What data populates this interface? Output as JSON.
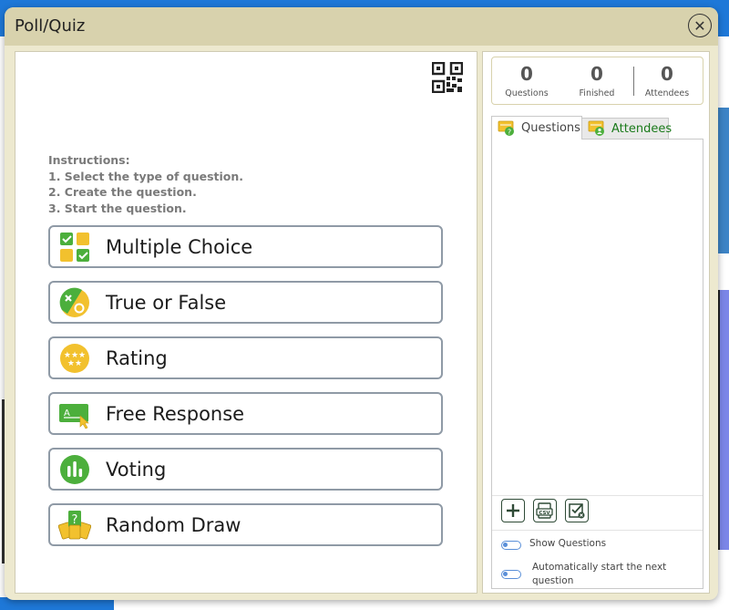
{
  "window": {
    "title": "Poll/Quiz",
    "close_label": "✕"
  },
  "instructions": {
    "heading": "Instructions:",
    "steps": [
      "1. Select the type of question.",
      "2. Create the question.",
      "3. Start the question."
    ]
  },
  "question_types": [
    {
      "label": "Multiple Choice",
      "icon": "multiple-choice-icon"
    },
    {
      "label": "True or False",
      "icon": "true-false-icon"
    },
    {
      "label": "Rating",
      "icon": "rating-icon"
    },
    {
      "label": "Free Response",
      "icon": "free-response-icon"
    },
    {
      "label": "Voting",
      "icon": "voting-icon"
    },
    {
      "label": "Random Draw",
      "icon": "random-draw-icon"
    }
  ],
  "stats": [
    {
      "value": "0",
      "label": "Questions"
    },
    {
      "value": "0",
      "label": "Finished"
    },
    {
      "value": "0",
      "label": "Attendees"
    }
  ],
  "tabs": {
    "questions": "Questions",
    "attendees": "Attendees",
    "active": "Questions"
  },
  "options": {
    "show_questions": "Show Questions",
    "auto_start_line1": "Automatically start the next",
    "auto_start_line2": "question"
  },
  "colors": {
    "title_bar": "#d8d2ad",
    "dialog_bg": "#ede9cf",
    "icon_green": "#4caf3c",
    "icon_yellow": "#f2c12e",
    "attendees_tab_text": "#1a7a1a"
  }
}
